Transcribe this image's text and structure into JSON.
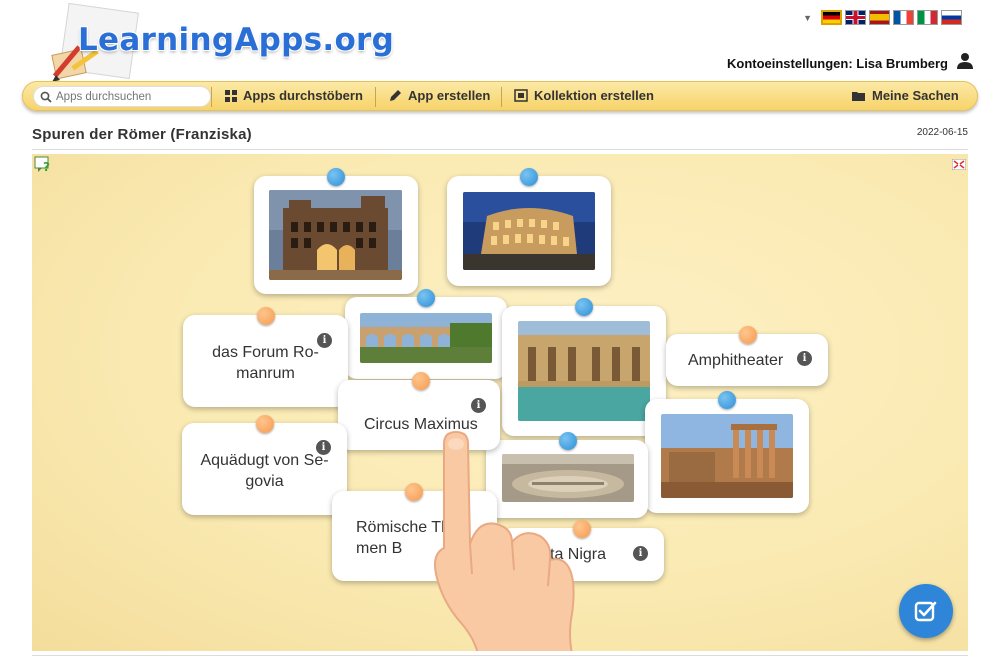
{
  "header": {
    "logo_text": "LearningApps.org",
    "account_label": "Kontoeinstellungen: Lisa Brumberg"
  },
  "languages": [
    {
      "code": "de",
      "colors": [
        "#000000",
        "#dd0000",
        "#ffce00"
      ]
    },
    {
      "code": "en",
      "colors": [
        "#012169",
        "#ffffff",
        "#c8102e"
      ]
    },
    {
      "code": "es",
      "colors": [
        "#aa151b",
        "#f1bf00",
        "#aa151b"
      ]
    },
    {
      "code": "fr",
      "colors": [
        "#0055a4",
        "#ffffff",
        "#ef4135"
      ]
    },
    {
      "code": "it",
      "colors": [
        "#009246",
        "#ffffff",
        "#ce2b37"
      ]
    },
    {
      "code": "ru",
      "colors": [
        "#ffffff",
        "#0039a6",
        "#d52b1e"
      ]
    }
  ],
  "nav": {
    "search_placeholder": "Apps durchsuchen",
    "browse": "Apps durchstöbern",
    "create_app": "App erstellen",
    "create_collection": "Kollektion erstellen",
    "my_stuff": "Meine Sachen"
  },
  "app": {
    "title": "Spuren der Römer (Franziska)",
    "date": "2022-06-15"
  },
  "cards": {
    "text": [
      {
        "label": "das Forum Romanrum",
        "display": "das Forum Ro-\nmanrum"
      },
      {
        "label": "Circus Maximus",
        "display": "Circus Maximus"
      },
      {
        "label": "Amphitheater",
        "display": "Amphitheater"
      },
      {
        "label": "Aquädugt von Segovia",
        "display": "Aquädugt von Se-\ngovia"
      },
      {
        "label": "Römische Thermen Bath",
        "display": "Römische The\nmen B"
      },
      {
        "label": "Porta Nigra",
        "display": "ta Nigra"
      }
    ],
    "images": [
      {
        "subject": "porta-nigra-photo"
      },
      {
        "subject": "colosseum-photo"
      },
      {
        "subject": "aqueduct-photo"
      },
      {
        "subject": "roman-baths-photo"
      },
      {
        "subject": "forum-romanum-photo"
      },
      {
        "subject": "circus-maximus-photo"
      }
    ]
  },
  "colors": {
    "accent_blue": "#2f86d9",
    "pin_orange": "#f59a4f",
    "pin_blue": "#2d8fd6",
    "navbar_yellow": "#f7d36a",
    "stage_background": "#faeab2"
  }
}
